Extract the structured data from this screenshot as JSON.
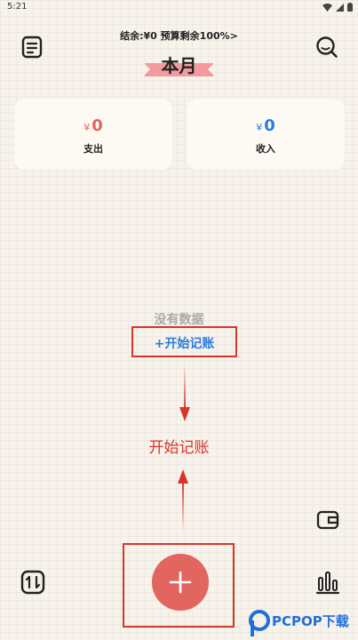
{
  "status_bar": {
    "time": "5:21"
  },
  "header": {
    "summary": "结余:¥0 预算剩余100%>",
    "month_title": "本月",
    "left_icon": "ledger-icon",
    "right_icon": "search-icon"
  },
  "cards": {
    "expense": {
      "currency": "¥",
      "amount": "0",
      "label": "支出",
      "color": "#e0655d"
    },
    "income": {
      "currency": "¥",
      "amount": "0",
      "label": "收入",
      "color": "#2a7de0"
    }
  },
  "empty_state": {
    "message": "没有数据",
    "start_link": "+开始记账"
  },
  "annotation": {
    "text": "开始记账",
    "color": "#d8352a"
  },
  "bottom_bar": {
    "left_icon": "sort-icon",
    "center_icon": "plus-icon",
    "right_icon": "bar-chart-icon",
    "wallet_icon": "wallet-icon"
  },
  "watermark": {
    "brand": "PCPOP下载"
  },
  "colors": {
    "accent": "#e36560",
    "highlight": "#f29a9f",
    "background": "#f7f2ea"
  }
}
